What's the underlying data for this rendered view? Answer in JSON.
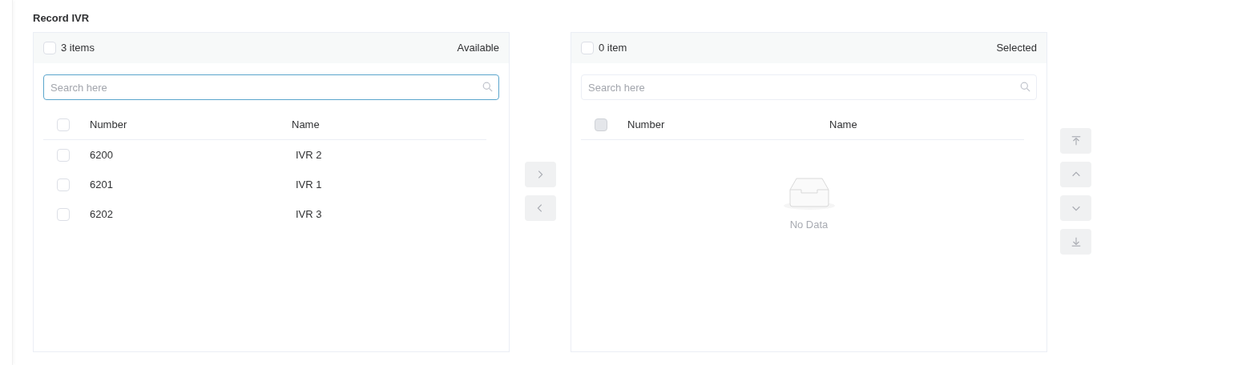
{
  "section_title": "Record IVR",
  "panels": [
    {
      "count": "3 items",
      "title": "Available",
      "search": {
        "placeholder": "Search here",
        "focused": true
      },
      "columns": [
        "Number",
        "Name"
      ],
      "header_checkbox": {
        "checked": false,
        "disabled": false
      },
      "rows": [
        {
          "number": "6200",
          "name": "IVR 2",
          "checked": false
        },
        {
          "number": "6201",
          "name": "IVR 1",
          "checked": false
        },
        {
          "number": "6202",
          "name": "IVR 3",
          "checked": false
        }
      ]
    },
    {
      "count": "0 item",
      "title": "Selected",
      "search": {
        "placeholder": "Search here",
        "focused": false
      },
      "columns": [
        "Number",
        "Name"
      ],
      "header_checkbox": {
        "checked": false,
        "disabled": true
      },
      "empty_text": "No Data"
    }
  ],
  "transfer_buttons": [
    {
      "kind": "right"
    },
    {
      "kind": "left"
    }
  ],
  "order_buttons": [
    {
      "kind": "top"
    },
    {
      "kind": "up"
    },
    {
      "kind": "down"
    },
    {
      "kind": "bottom"
    }
  ]
}
